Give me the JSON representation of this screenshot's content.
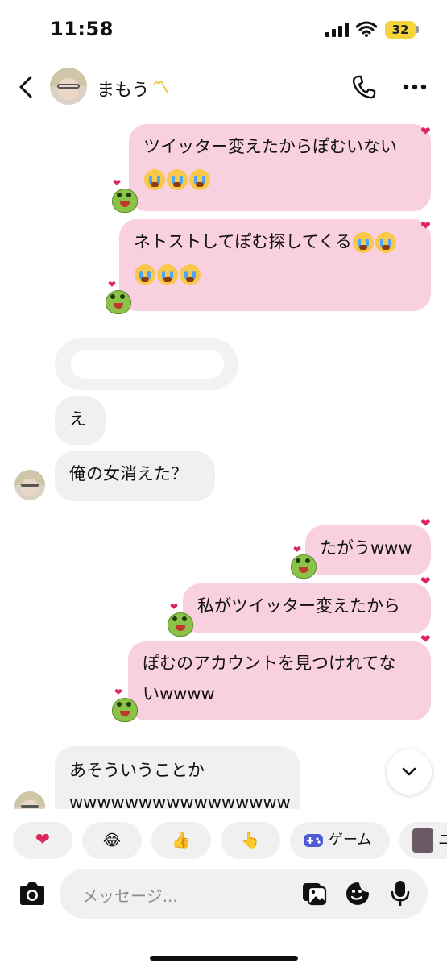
{
  "status_bar": {
    "time": "11:58",
    "battery": "32"
  },
  "header": {
    "name": "まもう",
    "name_decoration": "〽"
  },
  "messages": [
    {
      "side": "me",
      "lines": [
        "ツイッター変えたからぽむいない"
      ],
      "trailing_emoji_count": 3
    },
    {
      "side": "me",
      "lines": [
        "ネトストしてぽむ探してくる"
      ],
      "inline_emoji_count": 2,
      "trailing_emoji_count": 3
    },
    {
      "side": "them",
      "text": "え"
    },
    {
      "side": "them",
      "text": "俺の女消えた？"
    },
    {
      "side": "me",
      "text": "たがうwww"
    },
    {
      "side": "me",
      "text": "私がツイッター変えたから"
    },
    {
      "side": "me",
      "lines": [
        "ぽむのアカウントを見つけれてな",
        "いwwww"
      ]
    },
    {
      "side": "them",
      "lines": [
        "あそういうことか",
        "wwwwwwwwwwwwwwww"
      ]
    }
  ],
  "quick_reactions": {
    "heart": "❤",
    "laugh": "😂",
    "thumbs_up": "👍",
    "point": "👆",
    "game_label": "ゲーム",
    "next_initial": "ニ"
  },
  "composer": {
    "placeholder": "メッセージ..."
  },
  "colors": {
    "my_bubble": "#f9d0e0",
    "their_bubble": "#f0f0f0",
    "heart": "#e0245e"
  }
}
